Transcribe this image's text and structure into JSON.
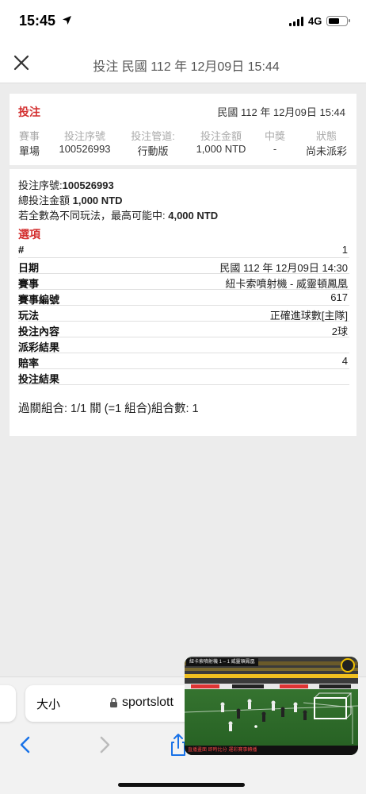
{
  "status_bar": {
    "time": "15:45",
    "network": "4G"
  },
  "header": {
    "title": "投注 民國 112 年 12月09日 15:44"
  },
  "summary": {
    "title": "投注",
    "date": "民國 112 年 12月09日 15:44",
    "columns": [
      "賽事",
      "投注序號",
      "投注管道:",
      "投注金額",
      "中獎",
      "狀態"
    ],
    "values": [
      "單場",
      "100526993",
      "行動版",
      "1,000 NTD",
      "-",
      "尚未派彩"
    ]
  },
  "detail": {
    "serial_label": "投注序號:",
    "serial_value": "100526993",
    "total_label": "總投注金額 ",
    "total_value": "1,000 NTD",
    "max_label": "若全數為不同玩法，最高可能中: ",
    "max_value": "4,000 NTD",
    "section_title": "選項",
    "rows": [
      {
        "key": "#",
        "value": "1"
      },
      {
        "key": "日期",
        "value": "民國 112 年 12月09日 14:30"
      },
      {
        "key": "賽事",
        "value": "紐卡索噴射機 - 威靈頓鳳凰"
      },
      {
        "key": "賽事編號",
        "value": "617"
      },
      {
        "key": "玩法",
        "value": "正確進球數[主隊]"
      },
      {
        "key": "投注內容",
        "value": "2球"
      },
      {
        "key": "派彩結果",
        "value": ""
      },
      {
        "key": "賠率",
        "value": "4"
      },
      {
        "key": "投注結果",
        "value": ""
      }
    ],
    "parlay": "過關組合: 1/1 關 (=1 組合)組合數: 1"
  },
  "browser": {
    "text_size": "大小",
    "url": "sportslott"
  },
  "video_overlay": {
    "score_text": "紐卡索噴射機  1 – 1  威靈頓鳳凰",
    "caption_text": "直播畫面 即時比分 運彩賽事轉播"
  },
  "colors": {
    "accent": "#d32f2f",
    "page_background": "#ececec"
  }
}
